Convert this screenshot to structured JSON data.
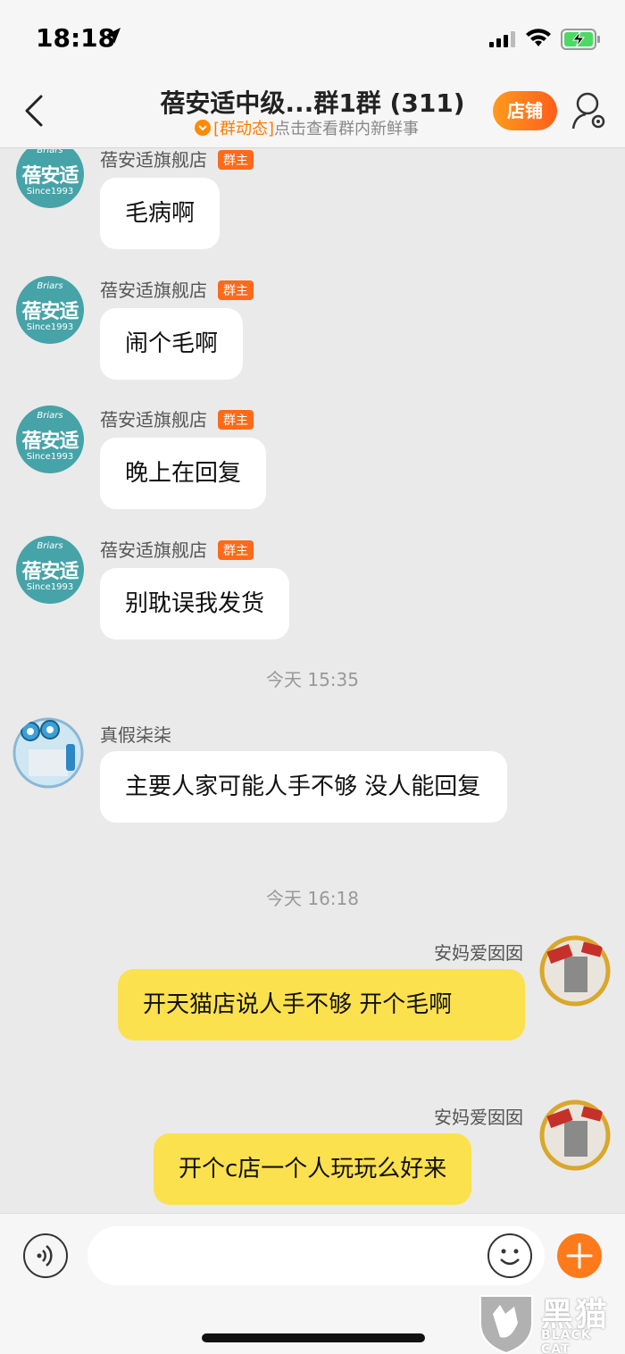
{
  "status_bar": {
    "time": "18:18"
  },
  "nav": {
    "title": "蓓安适中级...群1群 (311)",
    "subtitle_tag": "[群动态]",
    "subtitle_text": "点击查看群内新鲜事",
    "store_button": "店铺"
  },
  "messages": [
    {
      "sender": "蓓安适旗舰店",
      "badge": "群主",
      "text": "毛病啊"
    },
    {
      "sender": "蓓安适旗舰店",
      "badge": "群主",
      "text": "闹个毛啊"
    },
    {
      "sender": "蓓安适旗舰店",
      "badge": "群主",
      "text": "晚上在回复"
    },
    {
      "sender": "蓓安适旗舰店",
      "badge": "群主",
      "text": "别耽误我发货"
    },
    {
      "sender": "真假柒柒",
      "text": "主要人家可能人手不够 没人能回复"
    },
    {
      "sender": "安妈爱囡囡",
      "text": "开天猫店说人手不够 开个毛啊"
    },
    {
      "sender": "安妈爱囡囡",
      "text": "开个c店一个人玩玩么好来"
    }
  ],
  "timestamps": [
    "今天 15:35",
    "今天 16:18"
  ],
  "store_avatar": {
    "top": "Briars",
    "brand": "蓓安适",
    "since": "Since1993"
  },
  "watermark": {
    "main": "黑猫",
    "sub": "BLACK CAT"
  },
  "colors": {
    "accent": "#ff7a1a",
    "my_bubble": "#fce14f",
    "store_avatar": "#46a3a8"
  }
}
